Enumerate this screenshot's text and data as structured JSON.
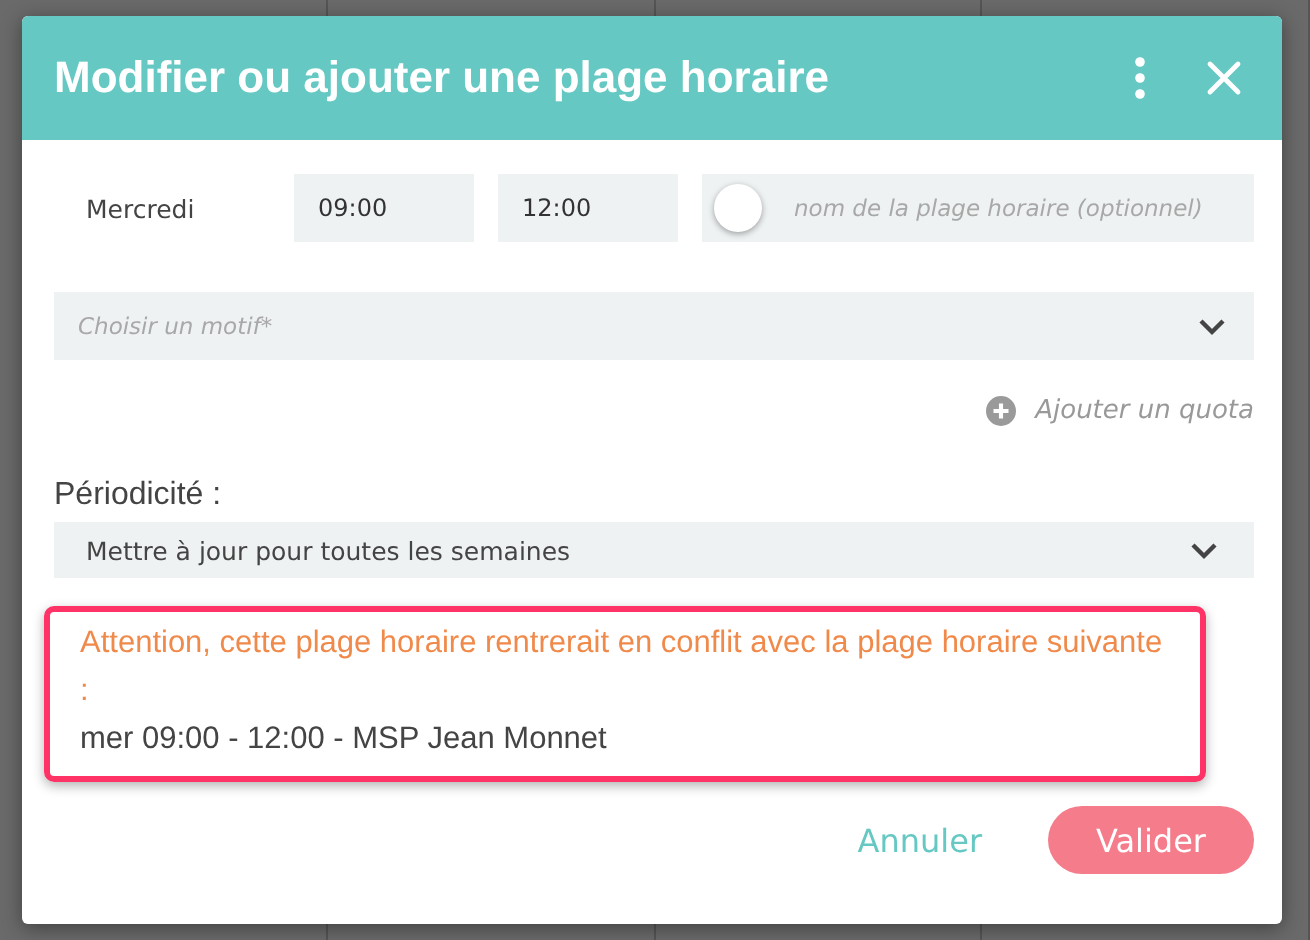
{
  "dialog": {
    "title": "Modifier ou ajouter une plage horaire"
  },
  "slot": {
    "day": "Mercredi",
    "start": "09:00",
    "end": "12:00",
    "name_toggle": {
      "on": false
    },
    "name_placeholder": "nom de la plage horaire (optionnel)"
  },
  "motif": {
    "placeholder": "Choisir un motif*"
  },
  "add_quota": "Ajouter un quota",
  "periodicity": {
    "label": "Périodicité :",
    "value": "Mettre à jour pour toutes les semaines"
  },
  "warning": {
    "message": "Attention, cette plage horaire rentrerait en conflit avec la plage horaire suivante :",
    "conflict": "mer 09:00 - 12:00 - MSP Jean Monnet"
  },
  "buttons": [
    {
      "kind": "text",
      "label": "Annuler"
    },
    {
      "kind": "primary",
      "label": "Valider"
    }
  ]
}
